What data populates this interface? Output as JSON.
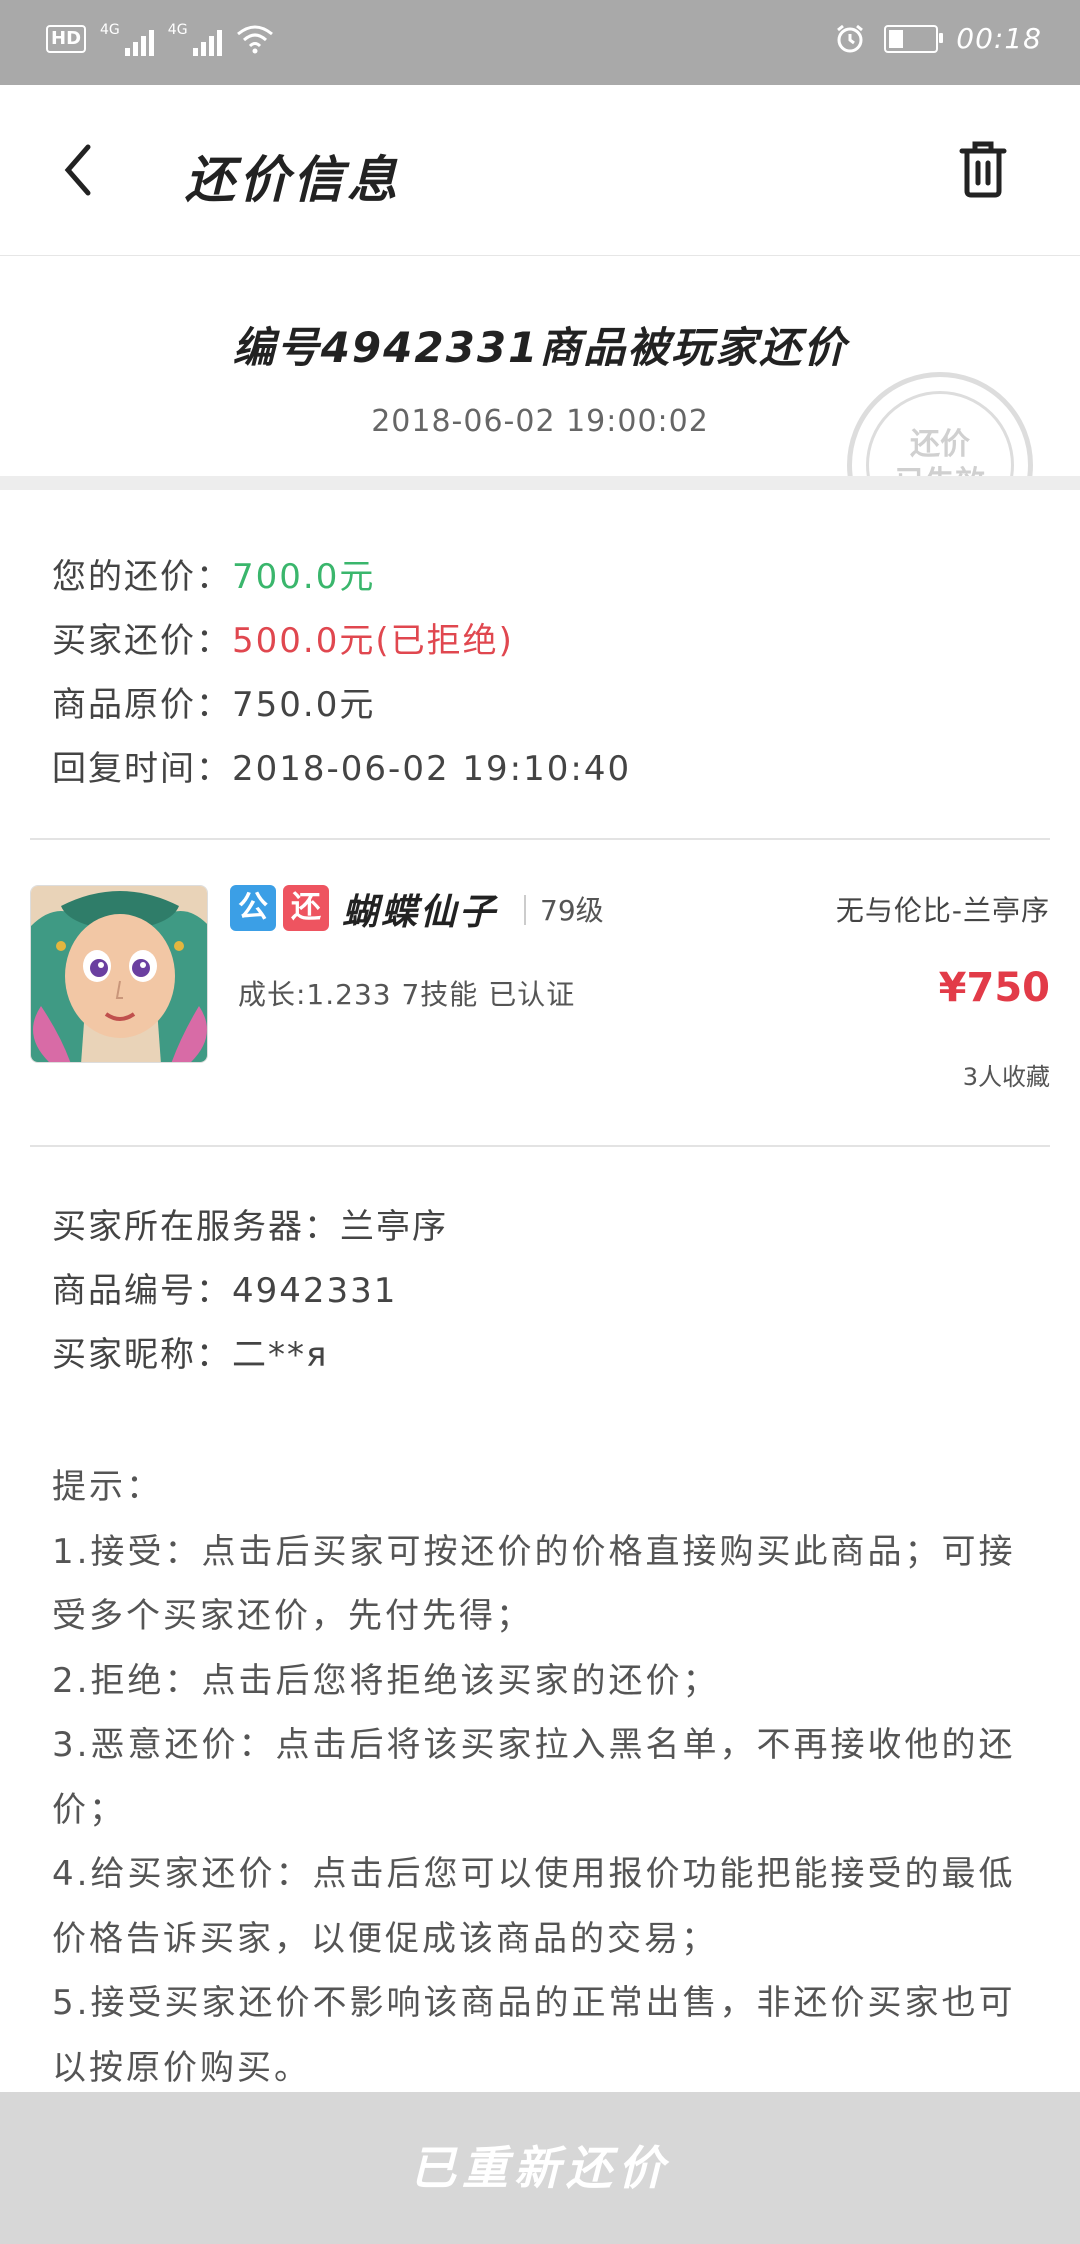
{
  "status_bar": {
    "hd": "HD",
    "net1": "4G",
    "net2": "4G",
    "time": "00:18",
    "icons": [
      "signal-icon",
      "wifi-icon",
      "alarm-icon",
      "battery-icon"
    ]
  },
  "app_bar": {
    "back_icon": "chevron-left-icon",
    "title": "还价信息",
    "trash_icon": "trash-icon"
  },
  "header": {
    "title": "编号4942331商品被玩家还价",
    "time": "2018-06-02 19:00:02",
    "stamp_line1": "还价",
    "stamp_line2": "已失效"
  },
  "price_info": {
    "your_offer_label": "您的还价：",
    "your_offer_value": "700.0元",
    "buyer_offer_label": "买家还价：",
    "buyer_offer_value": "500.0元(已拒绝)",
    "original_label": "商品原价：",
    "original_value": "750.0元",
    "reply_time_label": "回复时间：",
    "reply_time_value": "2018-06-02 19:10:40"
  },
  "item": {
    "tag_public": "公",
    "tag_offer": "还",
    "name": "蝴蝶仙子",
    "level": "79级",
    "server": "无与伦比-兰亭序",
    "detail": "成长:1.233 7技能 已认证",
    "price": "¥750",
    "favorites": "3人收藏"
  },
  "buyer_info": {
    "server_label": "买家所在服务器：",
    "server_value": "兰亭序",
    "item_id_label": "商品编号：",
    "item_id_value": "4942331",
    "nickname_label": "买家昵称：",
    "nickname_value": "二**я"
  },
  "tips": {
    "heading": "提示：",
    "items": [
      "1.接受：点击后买家可按还价的价格直接购买此商品；可接受多个买家还价，先付先得；",
      "2.拒绝：点击后您将拒绝该买家的还价；",
      "3.恶意还价：点击后将该买家拉入黑名单，不再接收他的还价；",
      "4.给买家还价：点击后您可以使用报价功能把能接受的最低价格告诉买家，以便促成该商品的交易；",
      "5.接受买家还价不影响该商品的正常出售，非还价买家也可以按原价购买。"
    ]
  },
  "bottom_button": "已重新还价"
}
